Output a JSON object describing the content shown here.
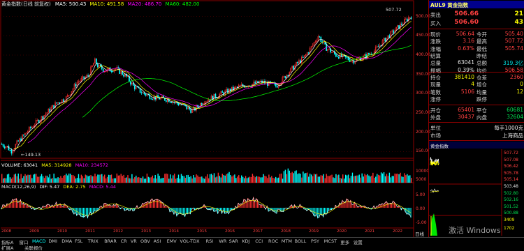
{
  "main_header": {
    "title": "黄金指数(日线 前复权)",
    "ma5_label": "MA5: 500.43",
    "ma10_label": "MA10: 491.58",
    "ma20_label": "MA20: 486.70",
    "ma60_label": "MA60: 482.00"
  },
  "price_chart": {
    "high_label": "507.72",
    "low_label": "149.13",
    "axis_ticks": [
      "500.00",
      "450.00",
      "400.00",
      "350.00",
      "300.00",
      "250.00",
      "200.00",
      "150.00"
    ]
  },
  "volume_header": {
    "volume_label": "VOLUME: 63041",
    "v5_label": "MA5: 314928",
    "v10_label": "MA10: 234572"
  },
  "volume_axis": [
    "10000",
    "5000"
  ],
  "macd_header": {
    "title": "MACD(12,26,9)",
    "dif_label": "DIF: 5.47",
    "dea_label": "DEA: 2.75",
    "macd_label": "MACD: 5.44"
  },
  "macd_axis": [
    "5.00",
    "0.00",
    "-5.00"
  ],
  "date_axis": [
    "2008",
    "2009",
    "2010",
    "2011",
    "2012",
    "2013",
    "2014",
    "2015",
    "2016",
    "2017",
    "2018",
    "2019",
    "2020",
    "2021",
    "2022"
  ],
  "period_label": "日线",
  "quote": {
    "title": "AUL9 黄金指数",
    "sell_label": "卖出",
    "sell_price": "506.66",
    "sell_qty": "21",
    "buy_label": "买入",
    "buy_price": "506.60",
    "buy_qty": "43",
    "rows": [
      {
        "l1": "现价",
        "v1": "506.64",
        "c1": "red",
        "l2": "今开",
        "v2": "505.40",
        "c2": "red"
      },
      {
        "l1": "涨跌",
        "v1": "3.16",
        "c1": "red",
        "l2": "最高",
        "v2": "507.72",
        "c2": "red"
      },
      {
        "l1": "涨幅",
        "v1": "0.63%",
        "c1": "red",
        "l2": "最低",
        "v2": "505.74",
        "c2": "red"
      },
      {
        "l1": "结算",
        "v1": "",
        "c1": "white",
        "l2": "昨结",
        "v2": "",
        "c2": "white"
      },
      {
        "l1": "总量",
        "v1": "63041",
        "c1": "white",
        "l2": "总额",
        "v2": "319.3亿",
        "c2": "cyan"
      },
      {
        "l1": "振幅",
        "v1": "0.39%",
        "c1": "white",
        "l2": "均价",
        "v2": "506.58",
        "c2": "red"
      }
    ],
    "rows2": [
      {
        "l1": "持仓",
        "v1": "381410",
        "c1": "yellow",
        "l2": "仓差",
        "v2": "2360",
        "c2": "red"
      },
      {
        "l1": "现量",
        "v1": "4",
        "c1": "yellow",
        "l2": "增仓",
        "v2": "0",
        "c2": "yellow"
      },
      {
        "l1": "笔数",
        "v1": "5106",
        "c1": "red",
        "l2": "均量",
        "v2": "12",
        "c2": "yellow"
      },
      {
        "l1": "涨停",
        "v1": "",
        "c1": "white",
        "l2": "跌停",
        "v2": "",
        "c2": "white"
      }
    ],
    "rows3": [
      {
        "l1": "开仓",
        "v1": "65401",
        "c1": "red",
        "l2": "平仓",
        "v2": "60681",
        "c2": "green"
      },
      {
        "l1": "外盘",
        "v1": "30437",
        "c1": "red",
        "l2": "内盘",
        "v2": "32604",
        "c2": "green"
      }
    ],
    "unit_label": "单位",
    "unit_value": "每手1000克",
    "market_label": "市场",
    "market_value": "上海商品",
    "mini_title": "黄金指数",
    "mini_axis": [
      "507.72",
      "507.08",
      "506.42",
      "505.78",
      "505.14",
      "503.48",
      "502.80",
      "502.16",
      "501.52",
      "500.88"
    ],
    "mini_vol_axis": [
      "3409",
      "1702"
    ]
  },
  "tabs_row1": [
    "指标A",
    "窗口",
    "MACD",
    "DMI",
    "DMA",
    "FSL",
    "TRIX",
    "BRAR",
    "CR",
    "VR",
    "OBV",
    "ASI",
    "EMV",
    "VOL-TDX",
    "RSI",
    "WR",
    "SAR",
    "KDJ",
    "CCI",
    "ROC",
    "MTM",
    "BOLL",
    "PSY",
    "MCST",
    "更多",
    "设置"
  ],
  "tabs_row2": [
    "扩展A",
    "关联报价"
  ],
  "active_tab": "MACD",
  "watermark": "激活 Windows",
  "colors": {
    "up": "#ff3030",
    "down": "#00ffff",
    "ma5": "#ffffff",
    "ma10": "#ffff00",
    "ma20": "#ff00ff",
    "ma60": "#00ff00",
    "panel_border": "#8b0000"
  }
}
